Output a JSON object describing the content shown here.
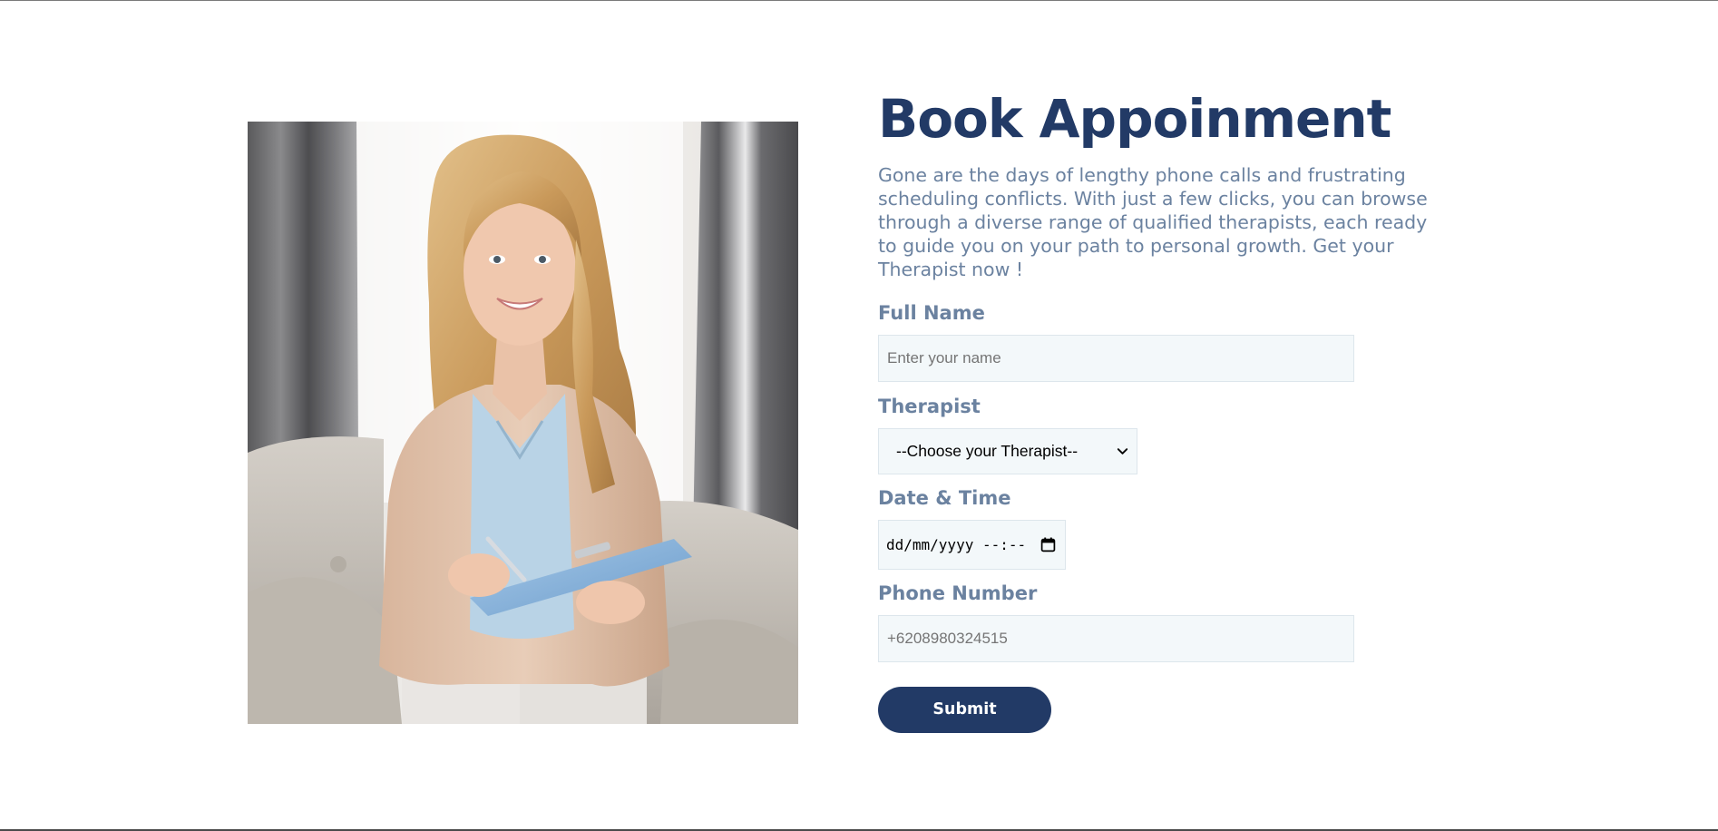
{
  "page": {
    "title": "Book Appoinment",
    "intro": "Gone are the days of lengthy phone calls and frustrating scheduling conflicts. With just a few clicks, you can browse through a diverse range of qualified therapists, each ready to guide you on your path to personal growth. Get your Therapist now !"
  },
  "form": {
    "full_name": {
      "label": "Full Name",
      "placeholder": "Enter your name",
      "value": ""
    },
    "therapist": {
      "label": "Therapist",
      "selected": "--Choose your Therapist--"
    },
    "datetime": {
      "label": "Date & Time",
      "display": "dd/mm/yyyy --:--"
    },
    "phone": {
      "label": "Phone Number",
      "placeholder": "+6208980324515",
      "value": ""
    },
    "submit_label": "Submit"
  },
  "icons": {
    "therapist_dropdown": "chevron-down-icon",
    "datetime_picker": "calendar-icon"
  },
  "colors": {
    "heading": "#223a66",
    "body_text": "#6b82a0",
    "input_background": "#f3f8fa",
    "button_background": "#223a66",
    "button_text": "#ffffff"
  }
}
